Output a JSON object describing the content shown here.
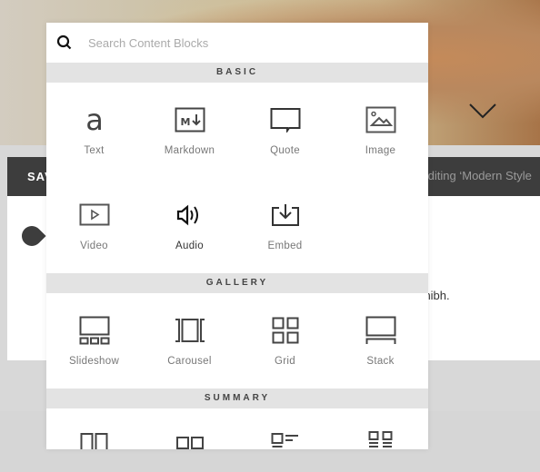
{
  "background": {
    "save_label": "SAV",
    "editing_label": "Editing ‘Modern Style",
    "body_text_fragment": "m nibh.",
    "scroll_down_icon": "chevron-down-icon",
    "marker_icon": "pin-icon"
  },
  "picker": {
    "search": {
      "placeholder": "Search Content Blocks",
      "value": "",
      "icon": "search-icon"
    },
    "sections": [
      {
        "title": "BASIC",
        "blocks": [
          {
            "label": "Text",
            "icon": "text-icon"
          },
          {
            "label": "Markdown",
            "icon": "markdown-icon"
          },
          {
            "label": "Quote",
            "icon": "quote-icon"
          },
          {
            "label": "Image",
            "icon": "image-icon"
          },
          {
            "label": "Video",
            "icon": "video-icon"
          },
          {
            "label": "Audio",
            "icon": "audio-icon",
            "hovered": true
          },
          {
            "label": "Embed",
            "icon": "embed-icon"
          }
        ]
      },
      {
        "title": "GALLERY",
        "blocks": [
          {
            "label": "Slideshow",
            "icon": "slideshow-icon"
          },
          {
            "label": "Carousel",
            "icon": "carousel-icon"
          },
          {
            "label": "Grid",
            "icon": "grid-icon"
          },
          {
            "label": "Stack",
            "icon": "stack-icon"
          }
        ]
      },
      {
        "title": "SUMMARY",
        "blocks": [
          {
            "icon": "summary-wall-icon"
          },
          {
            "icon": "summary-carousel-icon"
          },
          {
            "icon": "summary-list-icon"
          },
          {
            "icon": "summary-grid-icon"
          }
        ]
      }
    ]
  }
}
